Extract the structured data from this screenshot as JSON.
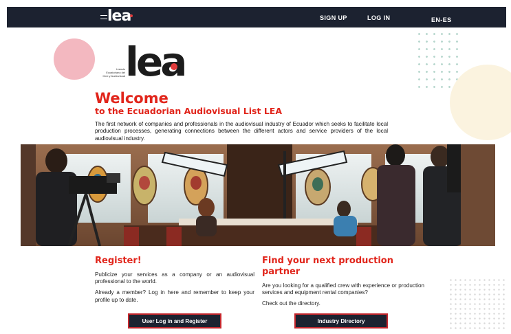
{
  "header": {
    "logo_text": "lea",
    "sign_up": "SIGN UP",
    "log_in": "LOG IN",
    "language": "EN-ES"
  },
  "logo": {
    "wordmark": "lea",
    "tagline_lines": [
      "Listado",
      "Ecuatoriano del",
      "Cine y Audiovisual"
    ]
  },
  "intro": {
    "title": "Welcome",
    "subtitle": "to the Ecuadorian Audiovisual List LEA",
    "body": "The first network of companies and professionals in the audiovisual industry of Ecuador which seeks to facilitate local production processes, generating connections between the different actors and service providers of the local audiovisual industry."
  },
  "register": {
    "title": "Register!",
    "text1": "Publicize your services as a company or an audiovisual professional to the world.",
    "text2": "Already a member?  Log in here and remember to keep your profile up to date.",
    "button": "User Log in and Register"
  },
  "partner": {
    "title": "Find your next production partner",
    "text1": "Are you looking for a qualified crew with experience or production services and equipment rental companies?",
    "text2": "Check out the directory.",
    "button": "Industry Directory"
  },
  "colors": {
    "navy": "#1c2230",
    "brand_red": "#e1251b",
    "pink": "#f3b8c0",
    "cream": "#fbf3df"
  }
}
